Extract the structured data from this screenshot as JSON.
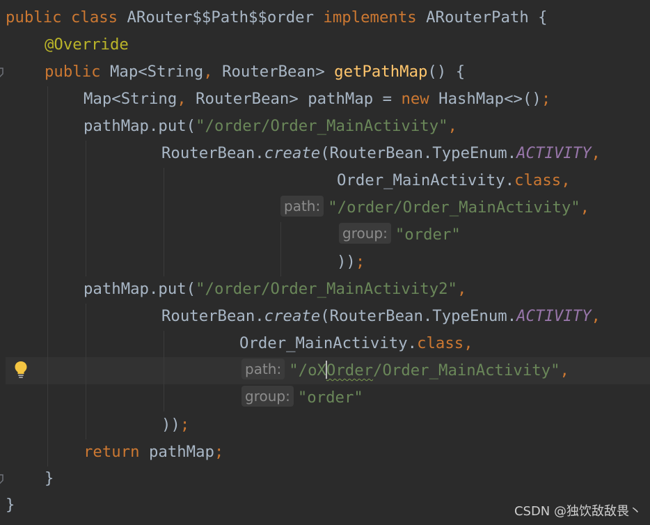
{
  "editor": {
    "lines": [
      {
        "segs": [
          [
            "kw",
            "public class "
          ],
          [
            "plain",
            "ARouter$$Path$$order "
          ],
          [
            "kw",
            "implements "
          ],
          [
            "plain",
            "ARouterPath {"
          ]
        ]
      },
      {
        "segs": [
          [
            "ann",
            "@Override"
          ]
        ]
      },
      {
        "segs": [
          [
            "kw",
            "public "
          ],
          [
            "plain",
            "Map<String"
          ],
          [
            "kw",
            ","
          ],
          [
            "plain",
            " RouterBean> "
          ],
          [
            "fn",
            "getPathMap"
          ],
          [
            "plain",
            "() {"
          ]
        ]
      },
      {
        "segs": [
          [
            "plain",
            "Map<String"
          ],
          [
            "kw",
            ","
          ],
          [
            "plain",
            " RouterBean> pathMap = "
          ],
          [
            "kw",
            "new "
          ],
          [
            "plain",
            "HashMap<>()"
          ],
          [
            "kw",
            ";"
          ]
        ]
      },
      {
        "segs": [
          [
            "plain",
            "pathMap.put("
          ],
          [
            "str",
            "\"/order/Order_MainActivity\""
          ],
          [
            "kw",
            ","
          ]
        ]
      },
      {
        "segs": [
          [
            "plain",
            "RouterBean."
          ],
          [
            "it",
            "create"
          ],
          [
            "plain",
            "(RouterBean.TypeEnum."
          ],
          [
            "const",
            "ACTIVITY"
          ],
          [
            "kw",
            ","
          ]
        ]
      },
      {
        "segs": [
          [
            "plain",
            "Order_MainActivity."
          ],
          [
            "kw",
            "class"
          ],
          [
            "kw",
            ","
          ]
        ]
      },
      {
        "segs": [
          [
            "hint",
            "path:"
          ],
          [
            "str",
            "\"/order/Order_MainActivity\""
          ],
          [
            "kw",
            ","
          ]
        ]
      },
      {
        "segs": [
          [
            "hint",
            "group:"
          ],
          [
            "str",
            "\"order\""
          ]
        ]
      },
      {
        "segs": [
          [
            "plain",
            "))"
          ],
          [
            "kw",
            ";"
          ]
        ]
      },
      {
        "segs": [
          [
            "plain",
            "pathMap.put("
          ],
          [
            "str",
            "\"/order/Order_MainActivity2\""
          ],
          [
            "kw",
            ","
          ]
        ]
      },
      {
        "segs": [
          [
            "plain",
            "RouterBean."
          ],
          [
            "it",
            "create"
          ],
          [
            "plain",
            "(RouterBean.TypeEnum."
          ],
          [
            "const",
            "ACTIVITY"
          ],
          [
            "kw",
            ","
          ]
        ]
      },
      {
        "segs": [
          [
            "plain",
            "Order_MainActivity."
          ],
          [
            "kw",
            "class"
          ],
          [
            "kw",
            ","
          ]
        ]
      },
      {
        "segs": [
          [
            "hint",
            "path:"
          ],
          [
            "str",
            "\"/oX"
          ],
          [
            "caret",
            ""
          ],
          [
            "strtypo",
            "Order"
          ],
          [
            "str",
            "/Order_MainActivity\""
          ],
          [
            "kw",
            ","
          ]
        ]
      },
      {
        "segs": [
          [
            "hint",
            "group:"
          ],
          [
            "str",
            "\"order\""
          ]
        ]
      },
      {
        "segs": [
          [
            "plain",
            "))"
          ],
          [
            "kw",
            ";"
          ]
        ]
      },
      {
        "segs": [
          [
            "kw",
            "return "
          ],
          [
            "plain",
            "pathMap"
          ],
          [
            "kw",
            ";"
          ]
        ]
      },
      {
        "segs": [
          [
            "plain",
            "}"
          ]
        ]
      },
      {
        "segs": [
          [
            "plain",
            "}"
          ]
        ]
      }
    ]
  },
  "icons": {
    "gutter": [
      "override-marker-icon",
      "bulb-icon",
      "fold-marker-icon"
    ]
  },
  "colors": {
    "background": "#2b2b2b",
    "keyword": "#cc7832",
    "string": "#6a8759",
    "annotation": "#bbb529",
    "method": "#ffc66d",
    "constant": "#9876aa",
    "text": "#a9b7c6",
    "bulb": "#f4c542"
  },
  "watermark": "CSDN @独饮敌敌畏丶"
}
